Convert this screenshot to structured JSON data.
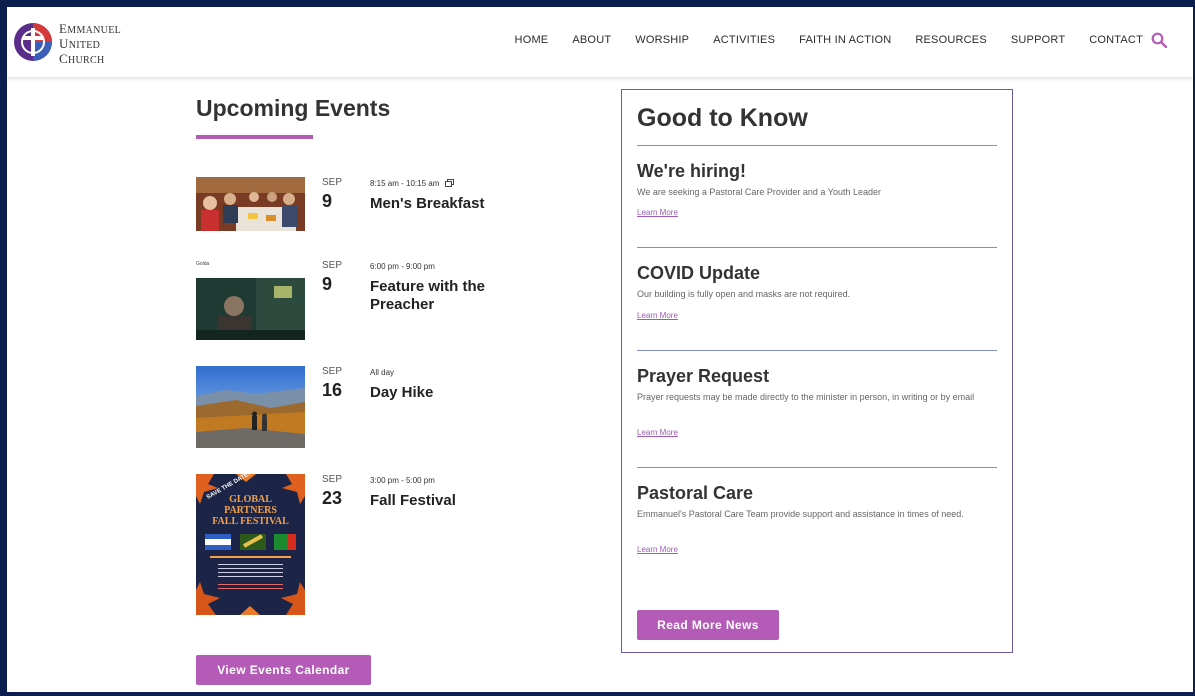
{
  "logo": {
    "line1": "Emmanuel",
    "line2": "United",
    "line3": "Church"
  },
  "nav": {
    "items": [
      "HOME",
      "ABOUT",
      "WORSHIP",
      "ACTIVITIES",
      "FAITH IN ACTION",
      "RESOURCES",
      "SUPPORT",
      "CONTACT"
    ]
  },
  "colors": {
    "accent": "#b35bb6",
    "frame": "#0d1f4f",
    "divider": "#7f93c9"
  },
  "events": {
    "title": "Upcoming Events",
    "items": [
      {
        "month": "SEP",
        "day": "9",
        "time": "8:15 am - 10:15 am",
        "name": "Men's Breakfast"
      },
      {
        "month": "SEP",
        "day": "9",
        "time": "6:00 pm - 9:00 pm",
        "name": "Feature with the Preacher"
      },
      {
        "month": "SEP",
        "day": "16",
        "time": "All day",
        "name": "Day Hike"
      },
      {
        "month": "SEP",
        "day": "23",
        "time": "3:00 pm - 5:00 pm",
        "name": "Fall Festival"
      }
    ],
    "calendar_button": "View Events Calendar",
    "movie_caption": "Golda"
  },
  "poster": {
    "save": "SAVE THE DATE!",
    "line1": "GLOBAL",
    "line2": "PARTNERS",
    "line3": "FALL FESTIVAL"
  },
  "good_to_know": {
    "title": "Good to Know",
    "items": [
      {
        "heading": "We're hiring!",
        "desc": "We are seeking a Pastoral Care Provider and a Youth Leader",
        "link": "Learn More"
      },
      {
        "heading": "COVID Update",
        "desc": "Our building is fully open and masks are not required.",
        "link": "Learn More"
      },
      {
        "heading": "Prayer Request",
        "desc": "Prayer requests may be made directly to the minister in person, in writing or by email",
        "link": "Learn More"
      },
      {
        "heading": "Pastoral Care",
        "desc": "Emmanuel's Pastoral Care Team provide support and assistance in times of need.",
        "link": "Learn More"
      }
    ],
    "read_more_button": "Read More News"
  }
}
